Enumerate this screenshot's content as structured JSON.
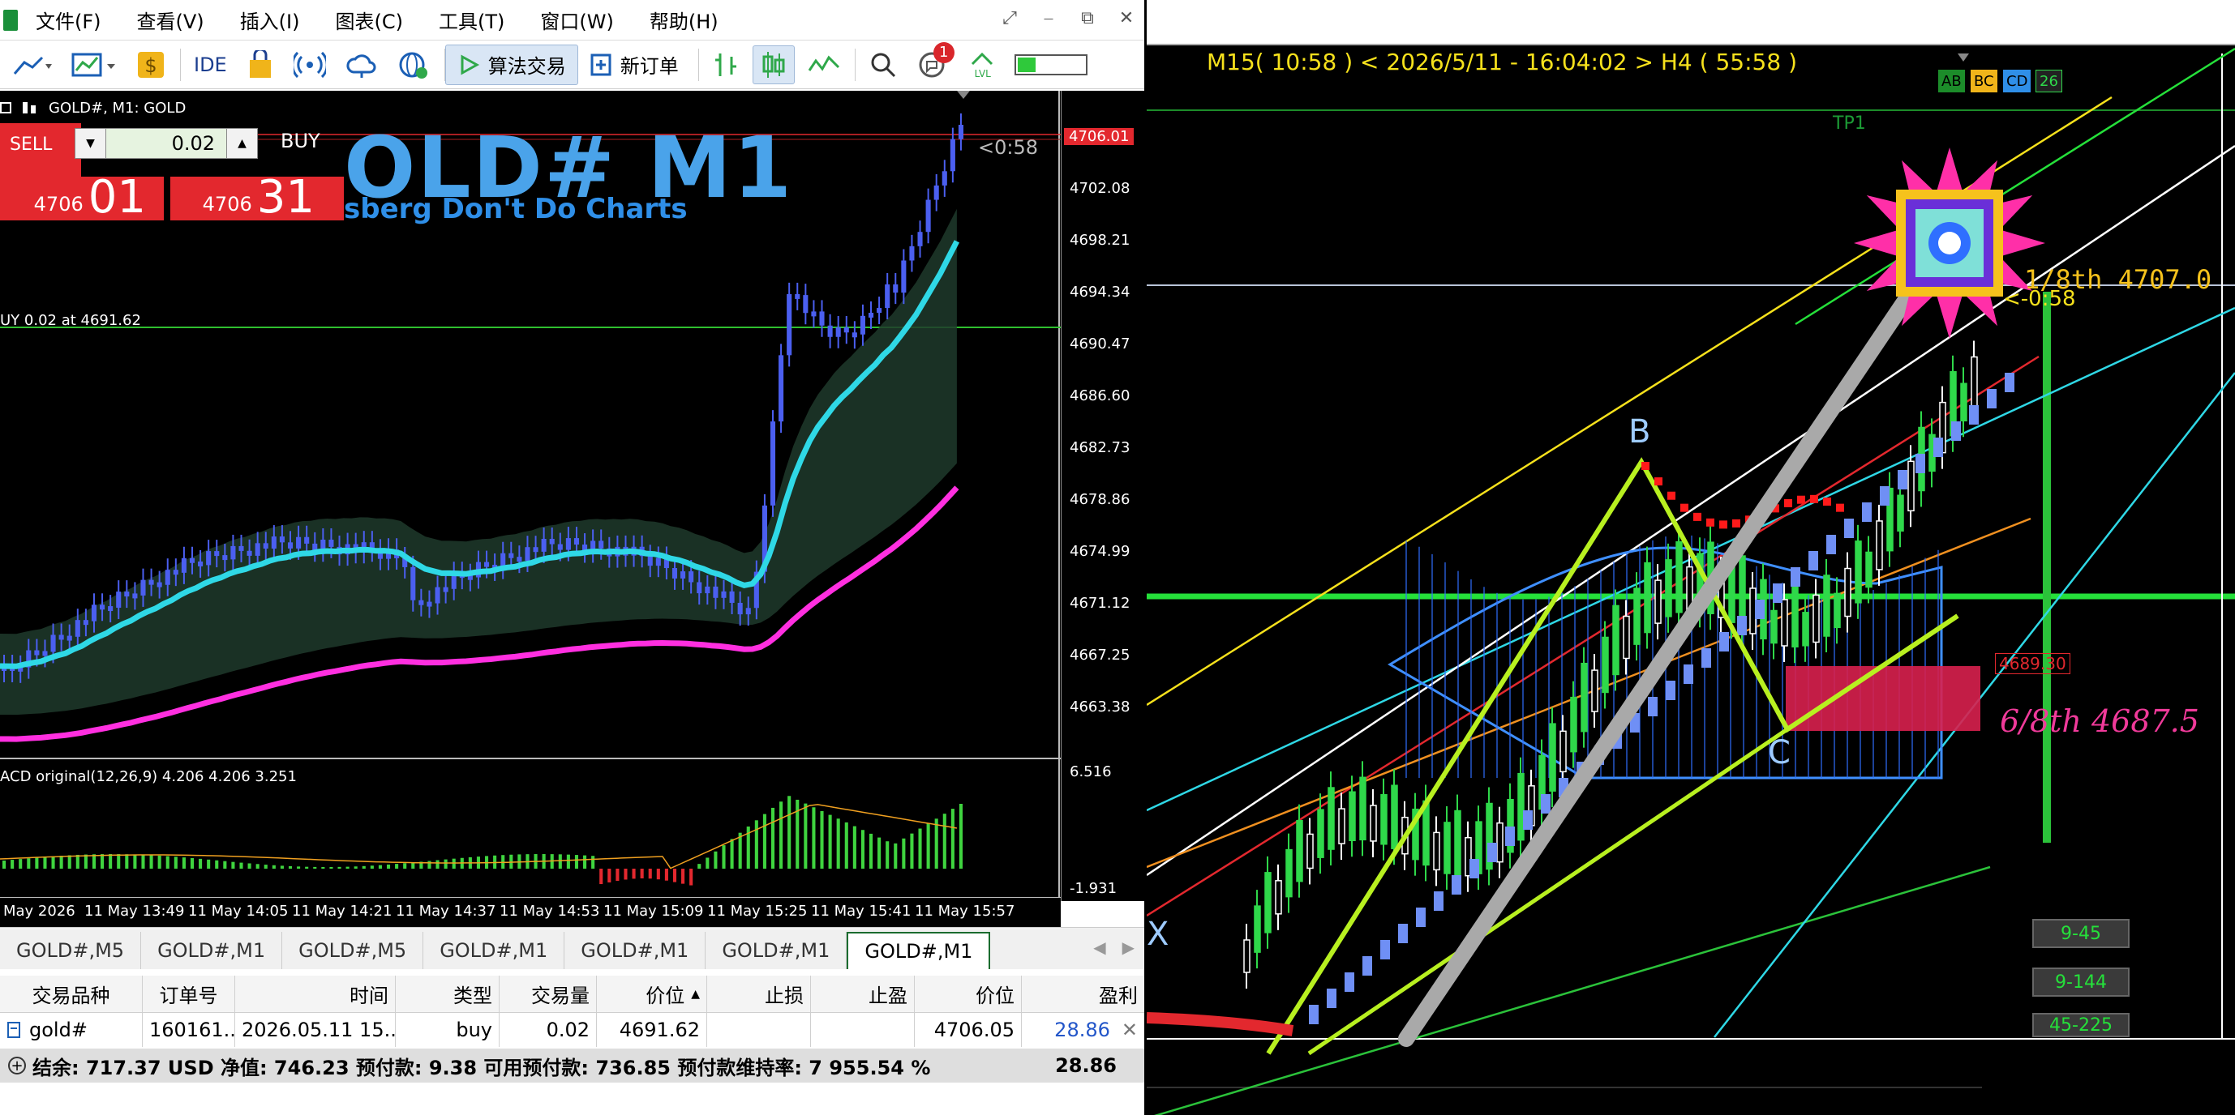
{
  "menu": {
    "items": [
      "文件(F)",
      "查看(V)",
      "插入(I)",
      "图表(C)",
      "工具(T)",
      "窗口(W)",
      "帮助(H)"
    ],
    "window_controls": [
      "⤢",
      "⎯",
      "⧉",
      "✕"
    ]
  },
  "toolbar": {
    "ide_label": "IDE",
    "algo_trading_label": "算法交易",
    "new_order_label": "新订单",
    "notification_count": "1",
    "lvl_label": "LVL"
  },
  "chart": {
    "title": "GOLD#, M1:  GOLD",
    "watermark": "OLD# M1",
    "watermark_sub": "sberg Don't Do Charts",
    "sell_label": "SELL",
    "buy_label": "BUY",
    "lot_value": "0.02",
    "sell_price_small": "4706",
    "sell_price_big": "01",
    "buy_price_small": "4706",
    "buy_price_big": "31",
    "countdown": "<0:58",
    "buy_line_label": "UY 0.02 at 4691.62",
    "current_price_tag": "4706.01",
    "price_axis": [
      "4702.08",
      "4698.21",
      "4694.34",
      "4690.47",
      "4686.60",
      "4682.73",
      "4678.86",
      "4674.99",
      "4671.12",
      "4667.25",
      "4663.38"
    ],
    "macd_label": "ACD original(12,26,9) 4.206 4.206 3.251",
    "macd_axis": [
      "6.516",
      "-1.931"
    ],
    "time_axis": [
      "May 2026",
      "11 May 13:49",
      "11 May 14:05",
      "11 May 14:21",
      "11 May 14:37",
      "11 May 14:53",
      "11 May 15:09",
      "11 May 15:25",
      "11 May 15:41",
      "11 May 15:57"
    ]
  },
  "tabs": {
    "items": [
      "GOLD#,M5",
      "GOLD#,M1",
      "GOLD#,M5",
      "GOLD#,M1",
      "GOLD#,M1",
      "GOLD#,M1",
      "GOLD#,M1"
    ],
    "active_index": 6,
    "nav_prev": "◀",
    "nav_next": "▶"
  },
  "positions": {
    "headers": [
      "交易品种",
      "订单号",
      "时间",
      "类型",
      "交易量",
      "价位",
      "止损",
      "止盈",
      "价位",
      "盈利"
    ],
    "sort_indicator": "▲",
    "row": {
      "symbol": "gold#",
      "order": "160161...",
      "time": "2026.05.11 15...",
      "type": "buy",
      "volume": "0.02",
      "open_price": "4691.62",
      "sl": "",
      "tp": "",
      "price": "4706.05",
      "profit": "28.86",
      "close_icon": "✕"
    },
    "footer": {
      "summary": "结余: 717.37 USD  净值: 746.23  预付款: 9.38  可用预付款: 736.85  预付款维持率: 7 955.54 %",
      "total_profit": "28.86"
    }
  },
  "right_chart": {
    "status": "M15( 10:58 )   < 2026/5/11 - 16:04:02 >   H4 ( 55:58 )",
    "tp_label": "TP1",
    "abc_labels": [
      "AB",
      "BC",
      "CD",
      "26"
    ],
    "point_b": "B",
    "point_c": "C",
    "point_x": "X",
    "murrey_top": "1/8th   4707.0",
    "murrey_mid": "6/8th   4687.5",
    "countdown": "<-0:58",
    "price_tag": "4689.30",
    "ma_buttons": [
      "9-45",
      "9-144",
      "45-225"
    ]
  },
  "colors": {
    "buy_line": "#2fbf2f",
    "candles": "#4b5ff0",
    "ma_fast": "#2fd8e6",
    "ma_slow": "#ff2fe0",
    "macd": "#3fd43f",
    "sell_red": "#e3282e",
    "status_yellow": "#f6e11c",
    "profit_blue": "#2356c9"
  }
}
